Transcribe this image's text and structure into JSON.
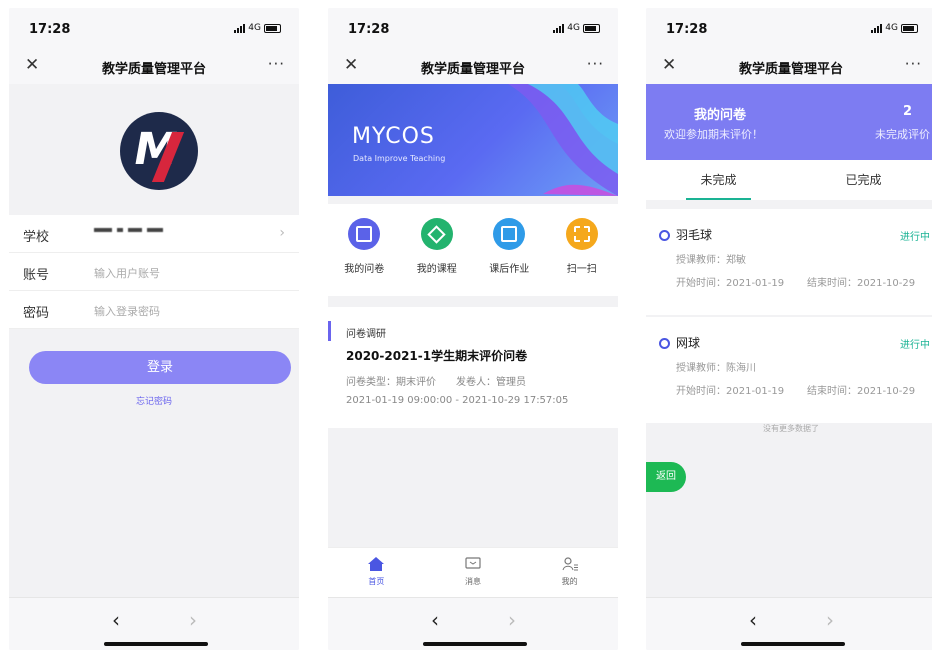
{
  "status": {
    "time": "17:28",
    "network": "4G"
  },
  "navbar": {
    "title": "教学质量管理平台",
    "close": "✕",
    "more": "···"
  },
  "browser": {
    "back": "‹",
    "forward": "›"
  },
  "login": {
    "logo_letter": "M",
    "fields": [
      {
        "label": "学校",
        "placeholder": ""
      },
      {
        "label": "账号",
        "placeholder": "输入用户账号"
      },
      {
        "label": "密码",
        "placeholder": "输入登录密码"
      }
    ],
    "button": "登录",
    "forgot": "忘记密码"
  },
  "home": {
    "brand": "MYCOS",
    "tagline": "Data Improve Teaching",
    "quick": [
      {
        "label": "我的问卷",
        "icon": "survey-icon",
        "color": "#5b62e8"
      },
      {
        "label": "我的课程",
        "icon": "course-icon",
        "color": "#23b36e"
      },
      {
        "label": "课后作业",
        "icon": "homework-icon",
        "color": "#2f9be8"
      },
      {
        "label": "扫一扫",
        "icon": "scan-icon",
        "color": "#f5a81c"
      }
    ],
    "card": {
      "category": "问卷调研",
      "title": "2020-2021-1学生期末评价问卷",
      "meta": "问卷类型：期末评价　　发卷人：管理员",
      "range": "2021-01-19 09:00:00 - 2021-10-29 17:57:05"
    },
    "tabs": [
      {
        "label": "首页",
        "icon": "home-icon"
      },
      {
        "label": "消息",
        "icon": "message-icon"
      },
      {
        "label": "我的",
        "icon": "profile-icon"
      }
    ]
  },
  "surveys": {
    "header_title": "我的问卷",
    "header_subtitle": "欢迎参加期末评价！",
    "count": "2",
    "count_label": "未完成评价",
    "tabs": [
      "未完成",
      "已完成"
    ],
    "items": [
      {
        "name": "羽毛球",
        "status": "进行中",
        "teacher": "授课教师：郑敏",
        "start": "开始时间：2021-01-19",
        "end": "结束时间：2021-10-29"
      },
      {
        "name": "网球",
        "status": "进行中",
        "teacher": "授课教师：陈海川",
        "start": "开始时间：2021-01-19",
        "end": "结束时间：2021-10-29"
      }
    ],
    "no_more": "没有更多数据了",
    "back_button": "返回"
  },
  "colors": {
    "accent": "#7d7cf2",
    "green": "#1ab394",
    "primary": "#4a56e2"
  }
}
